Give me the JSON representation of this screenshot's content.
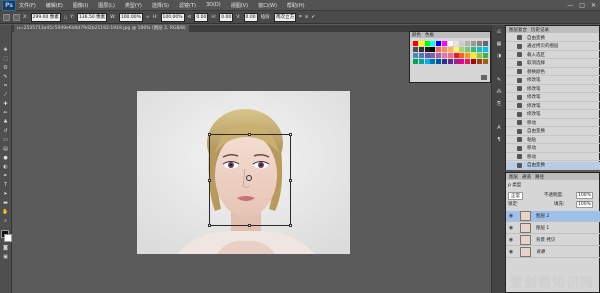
{
  "app": {
    "logo_text": "Ps"
  },
  "menu": {
    "items": [
      "文件(F)",
      "编辑(E)",
      "图像(I)",
      "图层(L)",
      "类型(Y)",
      "选择(S)",
      "滤镜(T)",
      "3D(D)",
      "视图(V)",
      "窗口(W)",
      "帮助(H)"
    ],
    "window_controls": [
      "—",
      "□",
      "✕"
    ]
  },
  "options": {
    "x_label": "X:",
    "x_value": "299.00 像素",
    "y_label": "Y:",
    "y_value": "136.50 像素",
    "w_label": "W:",
    "w_value": "100.00%",
    "h_label": "H:",
    "h_value": "100.00%",
    "angle_value": "0.00",
    "h_skew_label": "H:",
    "h_skew_value": "0.00",
    "v_skew_label": "V:",
    "v_skew_value": "0.00",
    "interp_label": "插值:",
    "interp_value": "两次立方"
  },
  "document": {
    "tab_title": "u=2535713a45c5949e6d4d79d2b21192:1919.jpg @ 100% (图层 2, RGB/8)"
  },
  "swatches_panel": {
    "tab_color": "颜色",
    "tab_swatches": "色板"
  },
  "history_panel": {
    "tab_layers_comp": "图层复合",
    "tab_history": "历史记录",
    "rows": [
      "自由变换",
      "通过拷贝的图层",
      "载入选区",
      "取消选择",
      "替换颜色",
      "修改笔",
      "修改笔",
      "修改笔",
      "修改笔",
      "修改笔",
      "移动",
      "自由变换",
      "粘贴",
      "移动",
      "移动",
      "自由变换"
    ]
  },
  "layers_panel": {
    "tab_layers": "图层",
    "tab_channels": "通道",
    "tab_paths": "路径",
    "kind_label": "ρ 类型",
    "blend_mode": "正常",
    "opacity_label": "不透明度:",
    "opacity_value": "100%",
    "lock_label": "锁定:",
    "fill_label": "填充:",
    "fill_value": "100%",
    "layers": [
      "图层 2",
      "图层 1",
      "背景 拷贝",
      "背景"
    ]
  },
  "watermark": {
    "text": "爱创根知识网"
  },
  "colors": {
    "accent": "#9ec1ea",
    "panel_bg": "#d6d6d6",
    "workspace": "#5b5b5b"
  }
}
